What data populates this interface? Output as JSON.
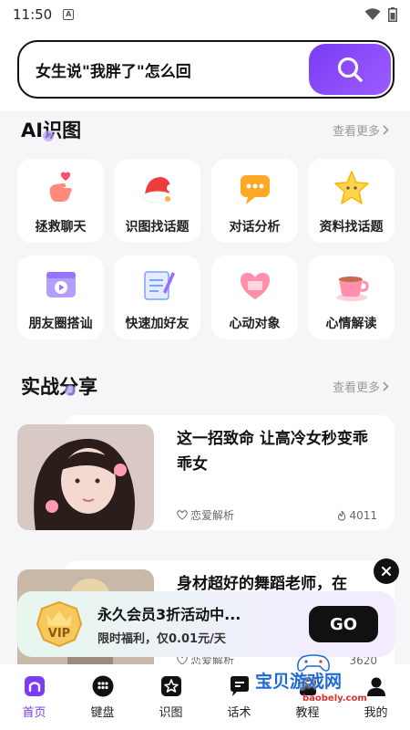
{
  "status": {
    "time": "11:50",
    "notif_glyph": "A"
  },
  "search": {
    "value": "女生说\"我胖了\"怎么回"
  },
  "ai_section": {
    "title": "AI识图",
    "more": "查看更多"
  },
  "grid": [
    {
      "label": "拯救聊天",
      "icon": "hand-heart-icon"
    },
    {
      "label": "识图找话题",
      "icon": "santa-hat-icon"
    },
    {
      "label": "对话分析",
      "icon": "chat-bubble-icon"
    },
    {
      "label": "资料找话题",
      "icon": "star-icon"
    },
    {
      "label": "朋友圈搭讪",
      "icon": "video-window-icon"
    },
    {
      "label": "快速加好友",
      "icon": "notepad-icon"
    },
    {
      "label": "心动对象",
      "icon": "heart-box-icon"
    },
    {
      "label": "心情解读",
      "icon": "coffee-cup-icon"
    }
  ],
  "share_section": {
    "title": "实战分享",
    "more": "查看更多"
  },
  "cards": [
    {
      "title": "这一招致命 让高冷女秒变乖乖女",
      "tag": "恋爱解析",
      "count": "4011"
    },
    {
      "title": "身材超好的舞蹈老师，在",
      "tag": "恋爱解析",
      "count": "3620"
    }
  ],
  "promo": {
    "badge": "VIP",
    "title": "永久会员3折活动中...",
    "subtitle": "限时福利，仅0.01元/天",
    "button": "GO"
  },
  "nav": [
    {
      "label": "首页",
      "icon": "home-icon"
    },
    {
      "label": "键盘",
      "icon": "keyboard-icon"
    },
    {
      "label": "识图",
      "icon": "image-star-icon"
    },
    {
      "label": "话术",
      "icon": "chat-icon"
    },
    {
      "label": "教程",
      "icon": "book-icon"
    },
    {
      "label": "我的",
      "icon": "user-icon"
    }
  ],
  "watermark": {
    "text": "宝贝游戏网",
    "url": "baobely.com"
  },
  "colors": {
    "accent": "#7a3cf5",
    "dark": "#111111"
  }
}
